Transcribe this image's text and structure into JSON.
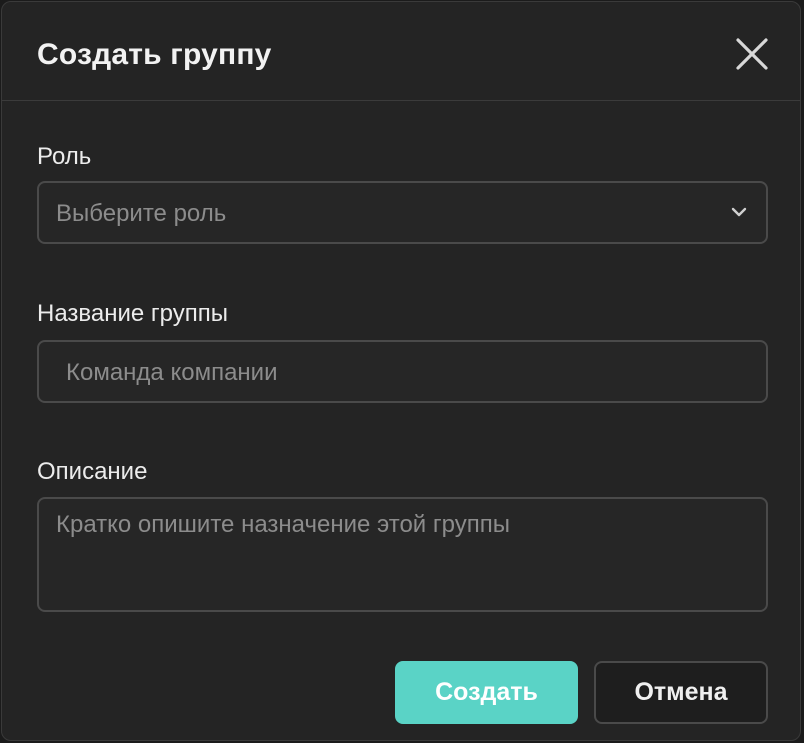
{
  "dialog": {
    "title": "Создать группу",
    "close_icon": "close-icon"
  },
  "fields": {
    "role": {
      "label": "Роль",
      "placeholder": "Выберите роль",
      "icon": "chevron-down-icon"
    },
    "group_name": {
      "label": "Название группы",
      "placeholder": "Команда компании"
    },
    "description": {
      "label": "Описание",
      "placeholder": "Кратко опишите назначение этой группы"
    }
  },
  "actions": {
    "create_label": "Создать",
    "cancel_label": "Отмена"
  },
  "colors": {
    "accent": "#5ad3c6",
    "background": "#242424"
  }
}
